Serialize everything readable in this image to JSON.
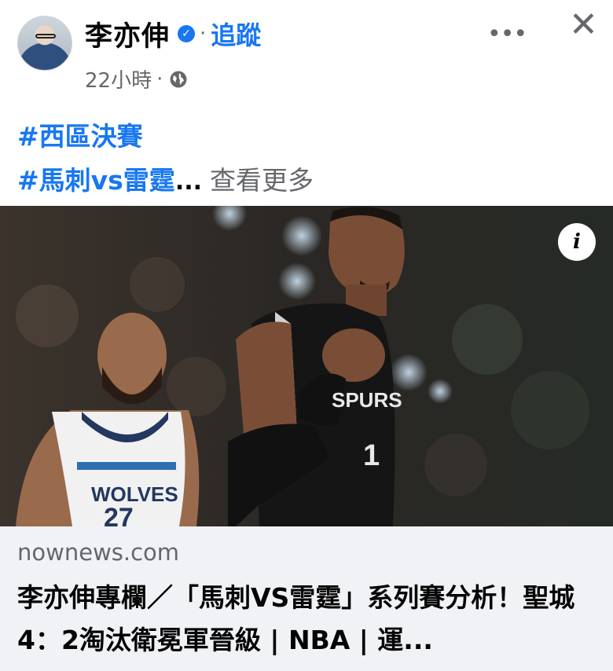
{
  "post": {
    "author": "李亦伸",
    "separator": "·",
    "follow_label": "追蹤",
    "timestamp": "22小時",
    "meta_separator": "·",
    "audience_icon": "globe-icon",
    "more_icon": "more-options-icon",
    "close_icon": "close-icon",
    "hashtags": [
      "#西區決賽",
      "#馬刺vs雷霆"
    ],
    "ellipsis": "...",
    "see_more_label": "查看更多"
  },
  "link_preview": {
    "info_label": "i",
    "domain": "nownews.com",
    "title": "李亦伸專欄／「馬刺VS雷霆」系列賽分析！聖城4：2淘汰衛冕軍晉級 | NBA | 運...",
    "jersey_left_text": "WOLVES",
    "jersey_left_number": "27",
    "jersey_right_text": "SPURS",
    "jersey_right_number": "1"
  },
  "colors": {
    "accent": "#1877f2",
    "secondary_text": "#65676b",
    "card_bg": "#f0f2f5"
  }
}
